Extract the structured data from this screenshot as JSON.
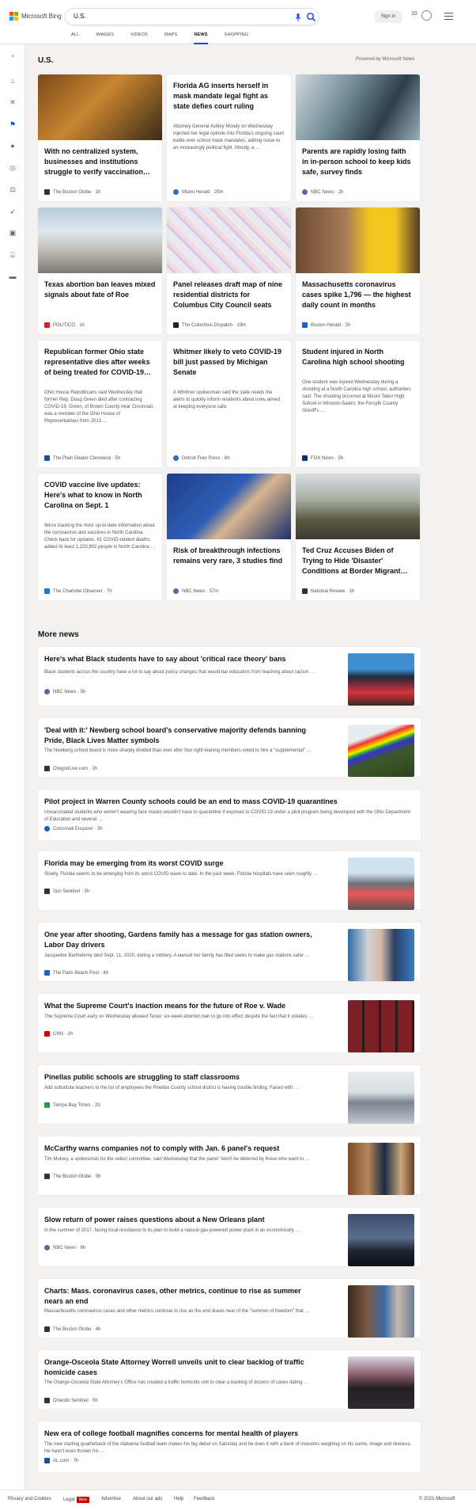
{
  "header": {
    "logo_text": "Microsoft Bing",
    "search_value": "U.S.",
    "signin_label": "Sign in",
    "points": "10"
  },
  "tabs": [
    "ALL",
    "IMAGES",
    "VIDEOS",
    "MAPS",
    "NEWS",
    "SHOPPING"
  ],
  "section": {
    "title": "U.S.",
    "powered_by": "Powered by Microsoft News"
  },
  "cards": [
    {
      "title": "With no centralized system, businesses and institutions struggle to verify vaccination…",
      "source": "The Boston Globe",
      "time": "1h"
    },
    {
      "title": "Florida AG inserts herself in mask mandate legal fight as state defies court ruling",
      "snippet": "Attorney General Ashley Moody on Wednesday injected her legal opinion into Florida's ongoing court battle over school mask mandates, adding noise to an increasingly political fight. Moody, a …",
      "source": "Miami Herald",
      "time": "20m"
    },
    {
      "title": "Parents are rapidly losing faith in in-person school to keep kids safe, survey finds",
      "source": "NBC News",
      "time": "2h"
    },
    {
      "title": "Texas abortion ban leaves mixed signals about fate of Roe",
      "source": "POLITICO",
      "time": "1h"
    },
    {
      "title": "Panel releases draft map of nine residential districts for Columbus City Council seats",
      "source": "The Columbus Dispatch",
      "time": "19m"
    },
    {
      "title": "Massachusetts coronavirus cases spike 1,796 — the highest daily count in months",
      "source": "Boston Herald",
      "time": "3h"
    },
    {
      "title": "Republican former Ohio state representative dies after weeks of being treated for COVID-19…",
      "snippet": "Ohio House Republicans said Wednesday that former Rep. Doug Green died after contracting COVID-19. Green, of Brown County near Cincinnati, was a member of the Ohio House of Representatives from 2013 …",
      "source": "The Plain Dealer Cleveland",
      "time": "5h"
    },
    {
      "title": "Whitmer likely to veto COVID-19 bill just passed by Michigan Senate",
      "snippet": "A Whitmer spokesman said the state needs the alerts to quickly inform residents about rules aimed at keeping everyone safe.",
      "source": "Detroit Free Press",
      "time": "6h"
    },
    {
      "title": "Student injured in North Carolina high school shooting",
      "snippet": "One student was injured Wednesday during a shooting at a North Carolina high school, authorities said. The shooting occurred at Mount Tabor High School in Winston-Salem, the Forsyth County Sheriff's …",
      "source": "FOX News",
      "time": "5h"
    },
    {
      "title": "COVID vaccine live updates: Here's what to know in North Carolina on Sept. 1",
      "snippet": "We're tracking the most up-to-date information about the coronavirus and vaccines in North Carolina. Check back for updates. 61 COVID-related deaths added At least 1,220,902 people in North Carolina …",
      "source": "The Charlotte Observer",
      "time": "7h"
    },
    {
      "title": "Risk of breakthrough infections remains very rare, 3 studies find",
      "source": "NBC News",
      "time": "57m"
    },
    {
      "title": "Ted Cruz Accuses Biden of Trying to Hide 'Disaster' Conditions at Border Migrant…",
      "source": "National Review",
      "time": "1h"
    }
  ],
  "more_news_title": "More news",
  "more_news": [
    {
      "title": "Here's what Black students have to say about 'critical race theory' bans",
      "snippet": "Black students across the country have a lot to say about policy changes that would bar educators from teaching about racism …",
      "source": "NBC News",
      "time": "5h"
    },
    {
      "title": "'Deal with it:' Newberg school board's conservative majority defends banning Pride, Black Lives Matter symbols",
      "snippet": "The Newberg school board is more sharply divided than ever after four right-leaning members voted to hire a \"supplemental\" …",
      "source": "OregonLive.com",
      "time": "3h"
    },
    {
      "title": "Pilot project in Warren County schools could be an end to mass COVID-19 quarantines",
      "snippet": "Unvaccinated students who weren't wearing face masks wouldn't have to quarantine if exposed to COVID-19 under a pilot program being developed with the Ohio Department of Education and several …",
      "source": "Cincinnati Enquirer",
      "time": "3h"
    },
    {
      "title": "Florida may be emerging from its worst COVID surge",
      "snippet": "Slowly, Florida seems to be emerging from its worst COVID wave to date. In the past week, Florida hospitals have seen roughly …",
      "source": "Sun Sentinel",
      "time": "3h"
    },
    {
      "title": "One year after shooting, Gardens family has a message for gas station owners, Labor Day drivers",
      "snippet": "Jacqueline Barthelemy died Sept. 11, 2020, during a robbery. A lawsuit her family has filed seeks to make gas stations safer …",
      "source": "The Palm Beach Post",
      "time": "4h"
    },
    {
      "title": "What the Supreme Court's inaction means for the future of Roe v. Wade",
      "snippet": "The Supreme Court early on Wednesday allowed Texas' six-week abortion ban to go into effect despite the fact that it violates …",
      "source": "CNN",
      "time": "2h"
    },
    {
      "title": "Pinellas public schools are struggling to staff classrooms",
      "snippet": "Add substitute teachers to the list of employees the Pinellas County school district is having trouble finding. Faced with …",
      "source": "Tampa Bay Times",
      "time": "2h"
    },
    {
      "title": "McCarthy warns companies not to comply with Jan. 6 panel's request",
      "snippet": "Tim Mulvey, a spokesman for the select committee, said Wednesday that the panel \"won't be deterred by those who want to …",
      "source": "The Boston Globe",
      "time": "3h"
    },
    {
      "title": "Slow return of power raises questions about a New Orleans plant",
      "snippet": "In the summer of 2017, facing local resistance to its plan to build a natural gas-powered power plant in an economically …",
      "source": "NBC News",
      "time": "6h"
    },
    {
      "title": "Charts: Mass. coronavirus cases, other metrics, continue to rise as summer nears an end",
      "snippet": "Massachusetts coronavirus cases and other metrics continue to rise as the end draws near of the \"summer of freedom\" that …",
      "source": "The Boston Globe",
      "time": "4h"
    },
    {
      "title": "Orange-Osceola State Attorney Worrell unveils unit to clear backlog of traffic homicide cases",
      "snippet": "The Orange-Osceola State Attorney's Office has created a traffic homicide unit to clear a backlog of dozens of cases dating …",
      "source": "Orlando Sentinel",
      "time": "5h"
    },
    {
      "title": "New era of college football magnifies concerns for mental health of players",
      "snippet": "The new starting quarterback of the Alabama football team makes his big debut on Saturday and he does it with a bank of investors weighing on his name, image and likeness. He hasn't even thrown his …",
      "source": "AL.com",
      "time": "7h"
    }
  ],
  "footer": {
    "privacy": "Privacy and Cookies",
    "legal": "Legal",
    "new_badge": "New",
    "advertise": "Advertise",
    "about_ads": "About our ads",
    "help": "Help",
    "feedback": "Feedback",
    "copyright": "© 2021 Microsoft"
  }
}
